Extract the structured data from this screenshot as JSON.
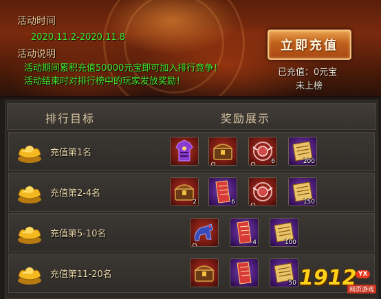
{
  "event": {
    "time_label": "活动时间",
    "time_value": "2020.11.2-2020.11.8",
    "desc_label": "活动说明",
    "desc_lines": [
      "活动期间累积充值50000元宝即可加入排行竞争！",
      "活动结束时对排行榜中的玩家发放奖励！"
    ],
    "recharge_button": "立即充值",
    "recharged": "已充值：0元宝",
    "rank_status": "未上榜"
  },
  "table": {
    "col_rank": "排行目标",
    "col_reward": "奖励展示",
    "rows": [
      {
        "name": "充值第1名",
        "items": [
          {
            "icon": "purple-armor-icon",
            "bg": "red",
            "count": "",
            "locked": false
          },
          {
            "icon": "treasure-chest-icon",
            "bg": "red",
            "count": "",
            "locked": true
          },
          {
            "icon": "wing-badge-icon",
            "bg": "red",
            "count": "6",
            "locked": true
          },
          {
            "icon": "gold-scroll-icon",
            "bg": "purple",
            "count": "200",
            "locked": false
          }
        ]
      },
      {
        "name": "充值第2-4名",
        "items": [
          {
            "icon": "treasure-chest-icon",
            "bg": "red",
            "count": "2",
            "locked": false
          },
          {
            "icon": "red-scroll-icon",
            "bg": "purple",
            "count": "6",
            "locked": false
          },
          {
            "icon": "wing-badge-icon",
            "bg": "red",
            "count": "",
            "locked": true
          },
          {
            "icon": "gold-scroll-icon",
            "bg": "purple",
            "count": "150",
            "locked": false
          }
        ]
      },
      {
        "name": "充值第5-10名",
        "items": [
          {
            "icon": "mount-icon",
            "bg": "red",
            "count": "",
            "locked": true
          },
          {
            "icon": "red-scroll-icon",
            "bg": "purple",
            "count": "4",
            "locked": false
          },
          {
            "icon": "gold-scroll-icon",
            "bg": "purple",
            "count": "100",
            "locked": false
          }
        ]
      },
      {
        "name": "充值第11-20名",
        "items": [
          {
            "icon": "treasure-chest-icon",
            "bg": "red",
            "count": "",
            "locked": false
          },
          {
            "icon": "red-scroll-icon",
            "bg": "purple",
            "count": "",
            "locked": false
          },
          {
            "icon": "gold-scroll-icon",
            "bg": "purple",
            "count": "50",
            "locked": false
          }
        ]
      }
    ]
  },
  "watermark": {
    "number": "1912",
    "badge": "YX",
    "site": "网页游戏"
  },
  "colors": {
    "highlight_green": "#3eea2f",
    "label_tan": "#e8c79a",
    "button_orange": "#c0601c"
  }
}
